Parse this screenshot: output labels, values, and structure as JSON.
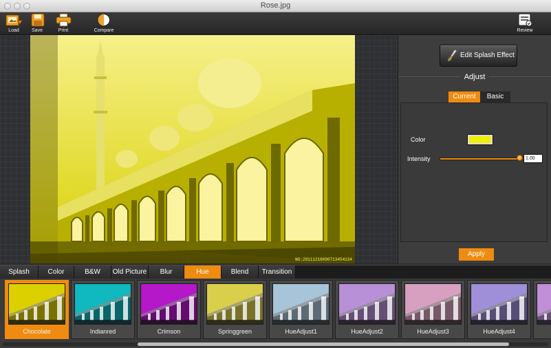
{
  "window": {
    "title": "Rose.jpg"
  },
  "toolbar": {
    "load_label": "Load",
    "save_label": "Save",
    "print_label": "Print",
    "compare_label": "Compare",
    "review_label": "Review"
  },
  "photo": {
    "stamp": "NO:20111216090713454134",
    "tint": "#e8e000"
  },
  "panel": {
    "edit_button_label": "Edit Splash Effect",
    "adjust_title": "Adjust",
    "tabs": [
      {
        "label": "Current",
        "selected": true
      },
      {
        "label": "Basic",
        "selected": false
      }
    ],
    "color_label": "Color",
    "color_value": "#f2ee00",
    "intensity_label": "Intensity",
    "intensity_value": "1.00",
    "intensity_fraction": 1.0,
    "apply_label": "Apply"
  },
  "tabs": [
    {
      "label": "Splash"
    },
    {
      "label": "Color"
    },
    {
      "label": "B&W"
    },
    {
      "label": "Old Picture"
    },
    {
      "label": "Blur"
    },
    {
      "label": "Hue"
    },
    {
      "label": "Blend"
    },
    {
      "label": "Transition"
    }
  ],
  "active_tab": "Hue",
  "thumbnails": [
    {
      "label": "Chocolate",
      "tint": "#ddd000",
      "selected": true
    },
    {
      "label": "Indianred",
      "tint": "#10b8c0",
      "selected": false
    },
    {
      "label": "Crimson",
      "tint": "#b418c8",
      "selected": false
    },
    {
      "label": "Springgreen",
      "tint": "#d9cf4a",
      "selected": false
    },
    {
      "label": "HueAdjust1",
      "tint": "#a8c4d8",
      "selected": false
    },
    {
      "label": "HueAdjust2",
      "tint": "#b890d8",
      "selected": false
    },
    {
      "label": "HueAdjust3",
      "tint": "#d8a0c0",
      "selected": false
    },
    {
      "label": "HueAdjust4",
      "tint": "#9f8fd8",
      "selected": false
    },
    {
      "label": "",
      "tint": "#c08fd8",
      "selected": false
    }
  ],
  "colors": {
    "accent": "#ef8b10",
    "panel": "#3d3d3d",
    "dark": "#1c1c1c"
  },
  "icons": {
    "load": "load-icon",
    "save": "floppy-icon",
    "print": "printer-icon",
    "compare": "half-circle-icon",
    "review": "review-icon",
    "brush": "paintbrush-icon"
  }
}
